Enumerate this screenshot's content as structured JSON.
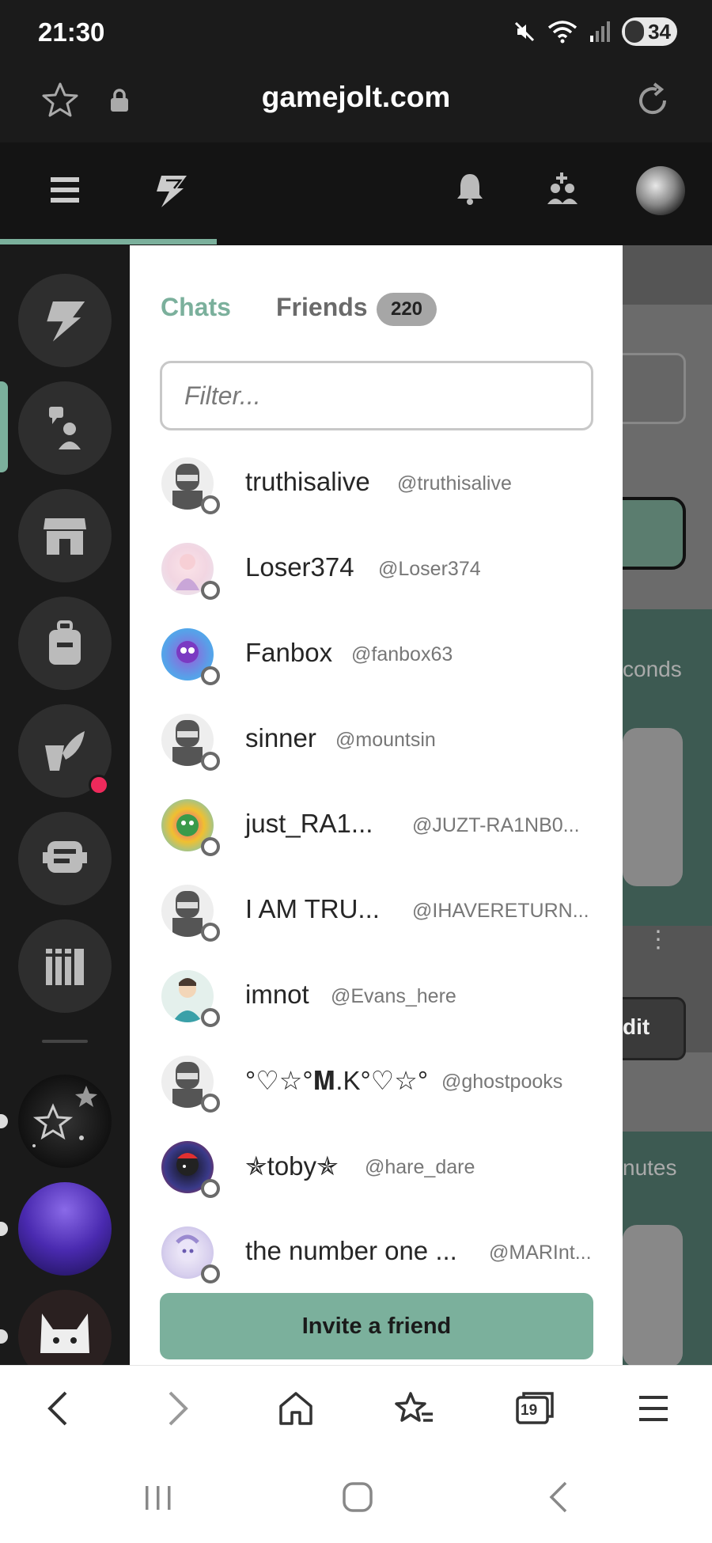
{
  "status_bar": {
    "time": "21:30",
    "battery": "34"
  },
  "address_bar": {
    "url": "gamejolt.com"
  },
  "drawer": {
    "tabs": {
      "chats": "Chats",
      "friends": "Friends",
      "friends_count": "220"
    },
    "filter_placeholder": "Filter...",
    "friends": [
      {
        "name": "truthisalive",
        "handle": "@truthisalive"
      },
      {
        "name": "Loser374",
        "handle": "@Loser374"
      },
      {
        "name": "Fanbox",
        "handle": "@fanbox63"
      },
      {
        "name": "sinner",
        "handle": "@mountsin"
      },
      {
        "name": "just_RA1...",
        "handle": "@JUZT-RA1NB0..."
      },
      {
        "name": "I AM TRU...",
        "handle": "@IHAVERETURN..."
      },
      {
        "name": "imnot",
        "handle": "@Evans_here"
      },
      {
        "name": "°♡☆°𝐌.K°♡☆°",
        "handle": "@ghostpooks"
      },
      {
        "name": "✯toby✯",
        "handle": "@hare_dare"
      },
      {
        "name": "the number one ...",
        "handle": "@MARInt..."
      }
    ],
    "invite_label": "Invite a friend"
  },
  "background": {
    "snippets": [
      "conds",
      "dit",
      "nutes"
    ]
  },
  "browser_nav": {
    "tabs_count": "19"
  },
  "colors": {
    "accent": "#7bb09c",
    "notification": "#ee2a5b"
  }
}
